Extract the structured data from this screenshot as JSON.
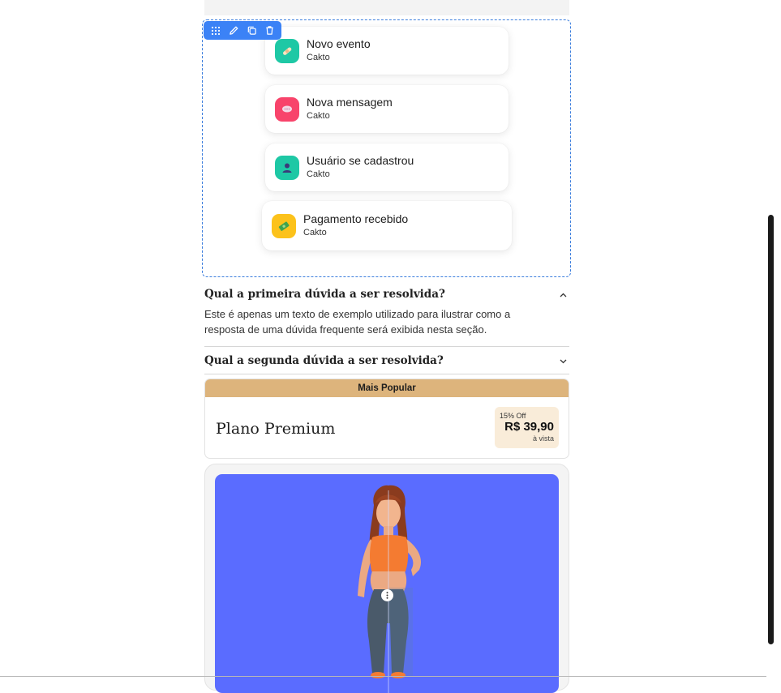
{
  "toolbar": {
    "icons": [
      "grip-icon",
      "pencil-icon",
      "duplicate-icon",
      "trash-icon"
    ]
  },
  "notifications": [
    {
      "title": "Novo evento",
      "subtitle": "Cakto",
      "icon": "bandage-icon",
      "color": "#1ec8a5"
    },
    {
      "title": "Nova mensagem",
      "subtitle": "Cakto",
      "icon": "chat-bubble-icon",
      "color": "#f8446b"
    },
    {
      "title": "Usuário se cadastrou",
      "subtitle": "Cakto",
      "icon": "user-icon",
      "color": "#1ec8a5"
    },
    {
      "title": "Pagamento recebido",
      "subtitle": "Cakto",
      "icon": "money-icon",
      "color": "#fcc21b"
    }
  ],
  "faq": [
    {
      "question": "Qual a primeira dúvida a ser resolvida?",
      "answer": "Este é apenas um texto de exemplo utilizado para ilustrar como a resposta de uma dúvida frequente será exibida nesta seção.",
      "expanded": true
    },
    {
      "question": "Qual a segunda dúvida a ser resolvida?",
      "expanded": false
    }
  ],
  "plan": {
    "badge": "Mais Popular",
    "name": "Plano Premium",
    "discount": "15% Off",
    "price": "R$ 39,90",
    "note": "à vista"
  },
  "image_card": {
    "background": "#5a6cff",
    "slider_icon": "drag-handle-icon"
  },
  "colors": {
    "accent": "#3b82f6",
    "badge": "#ddb47c",
    "price_bg": "#f9ecd9"
  }
}
